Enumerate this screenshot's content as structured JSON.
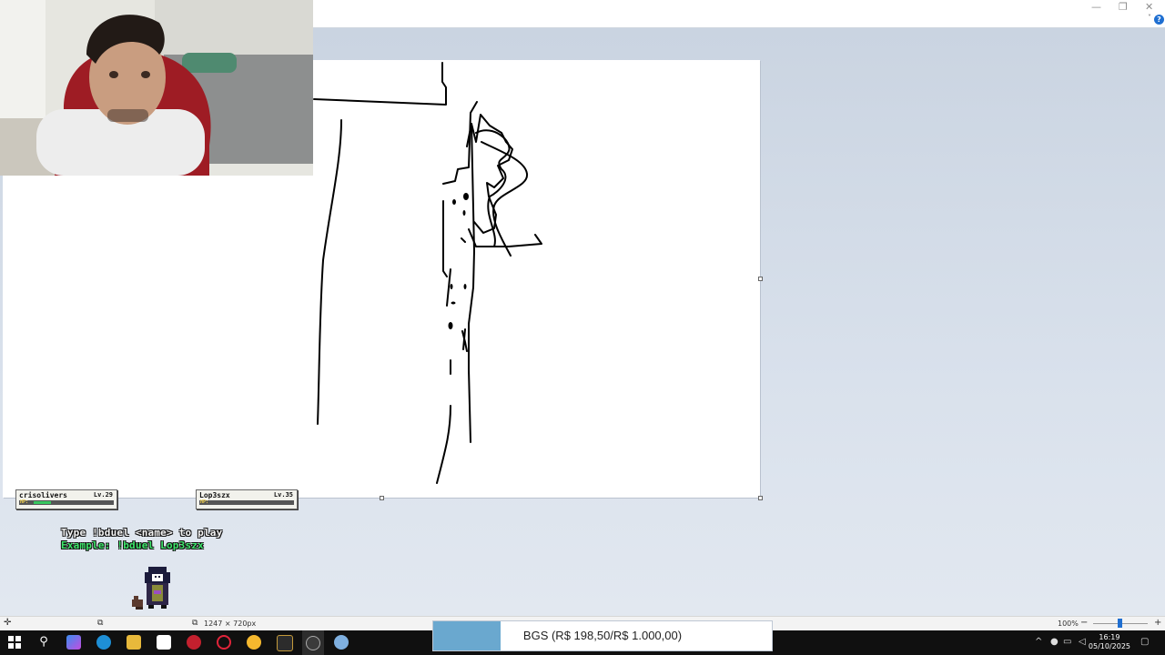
{
  "window": {
    "minimize_glyph": "—",
    "restore_glyph": "❐",
    "close_glyph": "✕",
    "help_glyph": "?",
    "ribbon_toggle_glyph": "˅"
  },
  "overlay": {
    "players": [
      {
        "name": "crisolivers",
        "level": "Lv.29",
        "hp_label": "HP:",
        "hp_fraction": 0.22
      },
      {
        "name": "Lop3szx",
        "level": "Lv.35",
        "hp_label": "HP:",
        "hp_fraction": 0.0
      }
    ],
    "instruction": "Type !bduel <name> to play",
    "example": "Example: !bduel Lop3szx",
    "instruction_color": "#f4f4f4",
    "example_color": "#3ee66b"
  },
  "statusbar": {
    "move_icon": "move-icon",
    "selection_icon": "selection-icon",
    "dimensions": "1247 × 720px",
    "zoom": "100%",
    "zoom_out": "−",
    "zoom_in": "+"
  },
  "goal": {
    "text": "BGS (R$ 198,50/R$ 1.000,00)",
    "progress": 0.1985,
    "fill_color": "#6aa8cf"
  },
  "taskbar": {
    "icons": [
      "start-icon",
      "search-icon",
      "copilot-icon",
      "edge-icon",
      "file-explorer-icon",
      "paint-icon",
      "app-red-icon",
      "opera-gx-icon",
      "chrome-icon",
      "app-gold-icon",
      "obs-icon",
      "paint-brush-icon"
    ],
    "time": "16:19",
    "date": "05/10/2025",
    "tray_icons": [
      "chevron-up-icon",
      "microphone-icon",
      "network-icon",
      "volume-icon",
      "notification-icon"
    ]
  }
}
